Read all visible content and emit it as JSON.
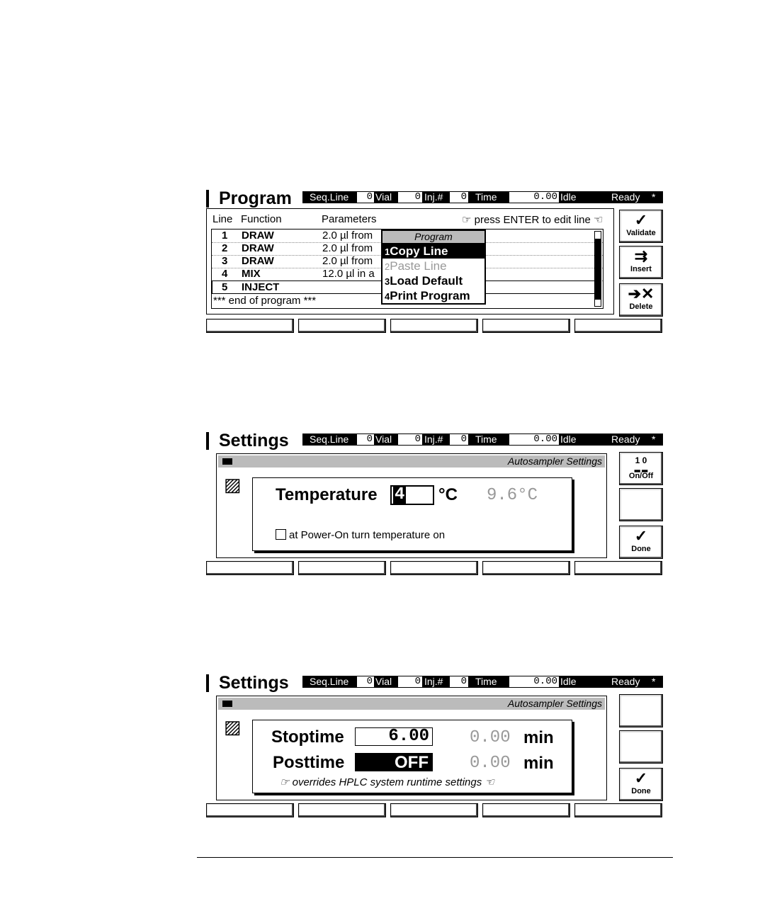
{
  "header": {
    "seq_line_label": "Seq.Line",
    "seq_line_value": "0",
    "vial_label": "Vial",
    "vial_value": "0",
    "inj_label": "Inj.#",
    "inj_value": "0",
    "time_label": "Time",
    "time_value": "0.00",
    "state": "Idle",
    "ready": "Ready",
    "star": "*"
  },
  "screen1": {
    "title": "Program",
    "col_line": "Line",
    "col_function": "Function",
    "col_parameters": "Parameters",
    "hint": "☞ press ENTER to edit line ☜",
    "rows": [
      {
        "line": "1",
        "function": "DRAW",
        "params": "2.0 µl from"
      },
      {
        "line": "2",
        "function": "DRAW",
        "params": "2.0 µl from"
      },
      {
        "line": "3",
        "function": "DRAW",
        "params": "2.0 µl from"
      },
      {
        "line": "4",
        "function": "MIX",
        "params": "12.0 µl in a"
      },
      {
        "line": "5",
        "function": "INJECT",
        "params": ""
      }
    ],
    "end_text": "*** end of program ***",
    "popup": {
      "title": "Program",
      "items": [
        {
          "num": "1",
          "label": "Copy Line"
        },
        {
          "num": "2",
          "label": "Paste Line"
        },
        {
          "num": "3",
          "label": "Load Default"
        },
        {
          "num": "4",
          "label": "Print Program"
        }
      ]
    },
    "buttons": {
      "validate": "Validate",
      "insert": "Insert",
      "delete": "Delete"
    }
  },
  "screen2": {
    "title": "Settings",
    "dialog_title": "Autosampler Settings",
    "temp_label": "Temperature",
    "temp_value": "4",
    "temp_unit": "°C",
    "temp_actual": "9.6°C",
    "checkbox_label": "at Power-On turn temperature on",
    "buttons": {
      "onoff_top": "1 0",
      "onoff": "On/Off",
      "done": "Done"
    }
  },
  "screen3": {
    "title": "Settings",
    "dialog_title": "Autosampler Settings",
    "stoptime_label": "Stoptime",
    "stoptime_value": "6.00",
    "stoptime_actual": "0.00",
    "posttime_label": "Posttime",
    "posttime_value": "OFF",
    "posttime_actual": "0.00",
    "unit": "min",
    "note": "☞ overrides HPLC system runtime settings ☜",
    "buttons": {
      "done": "Done"
    }
  }
}
